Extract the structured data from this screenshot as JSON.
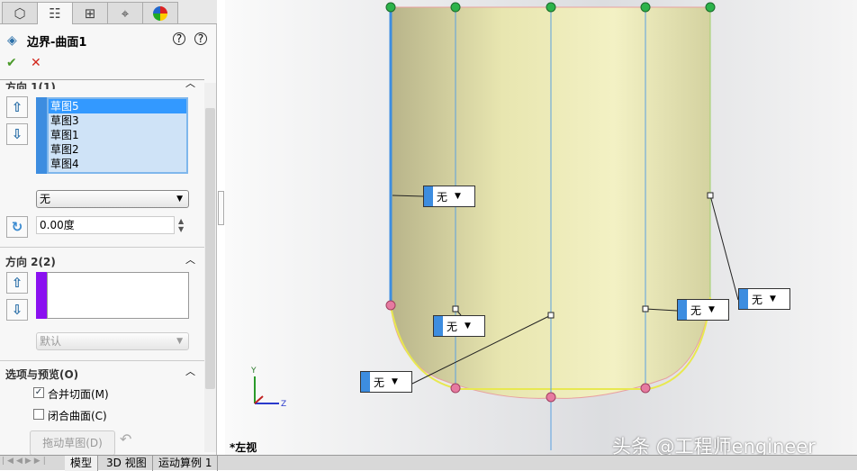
{
  "panel": {
    "tabs": [
      "feature-manager",
      "property-manager",
      "configuration-manager",
      "dimxpert",
      "display-manager"
    ],
    "title": "边界-曲面1",
    "ok": "✔",
    "cancel": "✕",
    "help_icons": [
      "?*",
      "?"
    ],
    "direction1": {
      "label": "方向 1(1)",
      "items": [
        "草图5",
        "草图3",
        "草图1",
        "草图2",
        "草图4"
      ],
      "selected": "草图5",
      "tangency": "无",
      "angle": "0.00度"
    },
    "direction2": {
      "label": "方向 2(2)",
      "tangency": "默认"
    },
    "options": {
      "label": "选项与预览(O)",
      "merge_tangent": {
        "label": "合并切面(M)",
        "checked": true
      },
      "close_surface": {
        "label": "闭合曲面(C)",
        "checked": false
      },
      "drag_sketch": "拖动草图(D)"
    }
  },
  "viewport": {
    "view_label": "*左视",
    "callouts": [
      "无",
      "无",
      "无",
      "无",
      "无"
    ],
    "triad": {
      "y": "Y",
      "z": "Z"
    },
    "watermark": "头条 @工程师engineer"
  },
  "bottom_tabs": [
    "模型",
    "3D 视图",
    "运动算例 1"
  ]
}
